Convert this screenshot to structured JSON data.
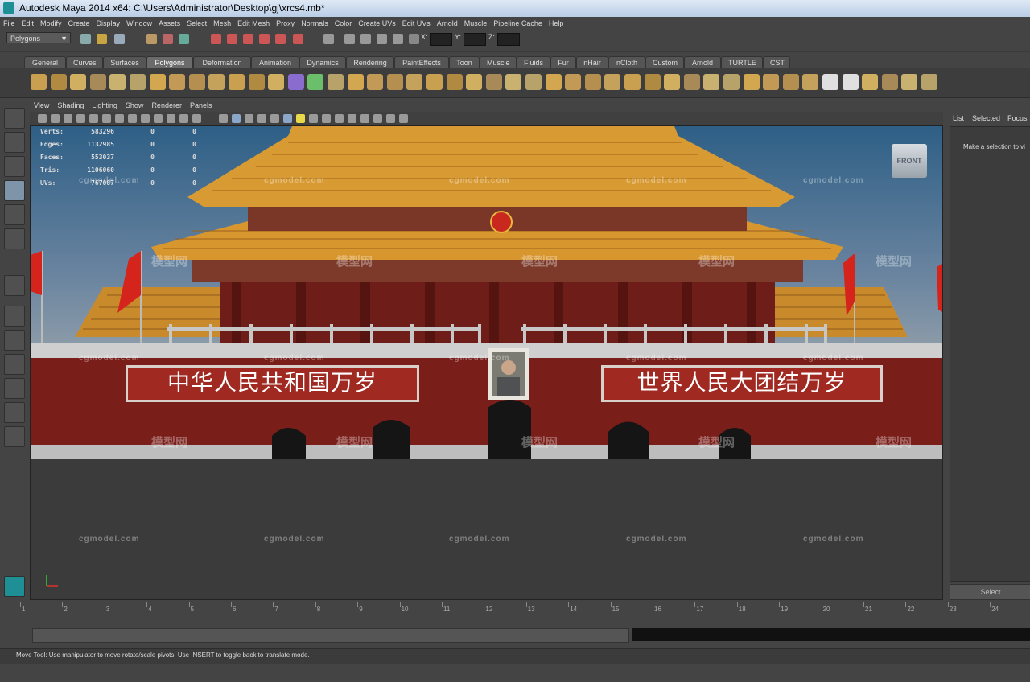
{
  "window": {
    "title": "Autodesk Maya 2014 x64: C:\\Users\\Administrator\\Desktop\\gj\\xrcs4.mb*"
  },
  "menubar": [
    "File",
    "Edit",
    "Modify",
    "Create",
    "Display",
    "Window",
    "Assets",
    "Select",
    "Mesh",
    "Edit Mesh",
    "Proxy",
    "Normals",
    "Color",
    "Create UVs",
    "Edit UVs",
    "Arnold",
    "Muscle",
    "Pipeline Cache",
    "Help"
  ],
  "statusline": {
    "mode": "Polygons",
    "x_label": "X:",
    "y_label": "Y:",
    "z_label": "Z:"
  },
  "shelf_tabs": [
    "General",
    "Curves",
    "Surfaces",
    "Polygons",
    "Deformation",
    "Animation",
    "Dynamics",
    "Rendering",
    "PaintEffects",
    "Toon",
    "Muscle",
    "Fluids",
    "Fur",
    "nHair",
    "nCloth",
    "Custom",
    "Arnold",
    "TURTLE",
    "CST"
  ],
  "active_shelf_tab": "Polygons",
  "panel_menu": [
    "View",
    "Shading",
    "Lighting",
    "Show",
    "Renderer",
    "Panels"
  ],
  "hud": {
    "rows": [
      {
        "label": "Verts:",
        "v1": "583296",
        "v2": "0",
        "v3": "0"
      },
      {
        "label": "Edges:",
        "v1": "1132985",
        "v2": "0",
        "v3": "0"
      },
      {
        "label": "Faces:",
        "v1": "553037",
        "v2": "0",
        "v3": "0"
      },
      {
        "label": "Tris:",
        "v1": "1106060",
        "v2": "0",
        "v3": "0"
      },
      {
        "label": "UVs:",
        "v1": "767087",
        "v2": "0",
        "v3": "0"
      }
    ]
  },
  "viewcube_label": "FRONT",
  "scene": {
    "banner_left": "中华人民共和国万岁",
    "banner_right": "世界人民大团结万岁"
  },
  "watermark": {
    "site": "cgmodel.com",
    "logo": "模型网"
  },
  "right_panel": {
    "tabs": [
      "List",
      "Selected",
      "Focus"
    ],
    "hint": "Make a selection to vi",
    "select_button": "Select"
  },
  "timeline": {
    "ticks": [
      "1",
      "2",
      "3",
      "4",
      "5",
      "6",
      "7",
      "8",
      "9",
      "10",
      "11",
      "12",
      "13",
      "14",
      "15",
      "16",
      "17",
      "18",
      "19",
      "20",
      "21",
      "22",
      "23",
      "24"
    ]
  },
  "help_line": "Move Tool: Use manipulator to move rotate/scale pivots. Use INSERT to toggle back to translate mode.",
  "colors": {
    "accent_cyan": "#1f8f96",
    "wall_red": "#7a1e1a",
    "banner_red": "#a02a22",
    "roof_gold": "#d8962f"
  }
}
